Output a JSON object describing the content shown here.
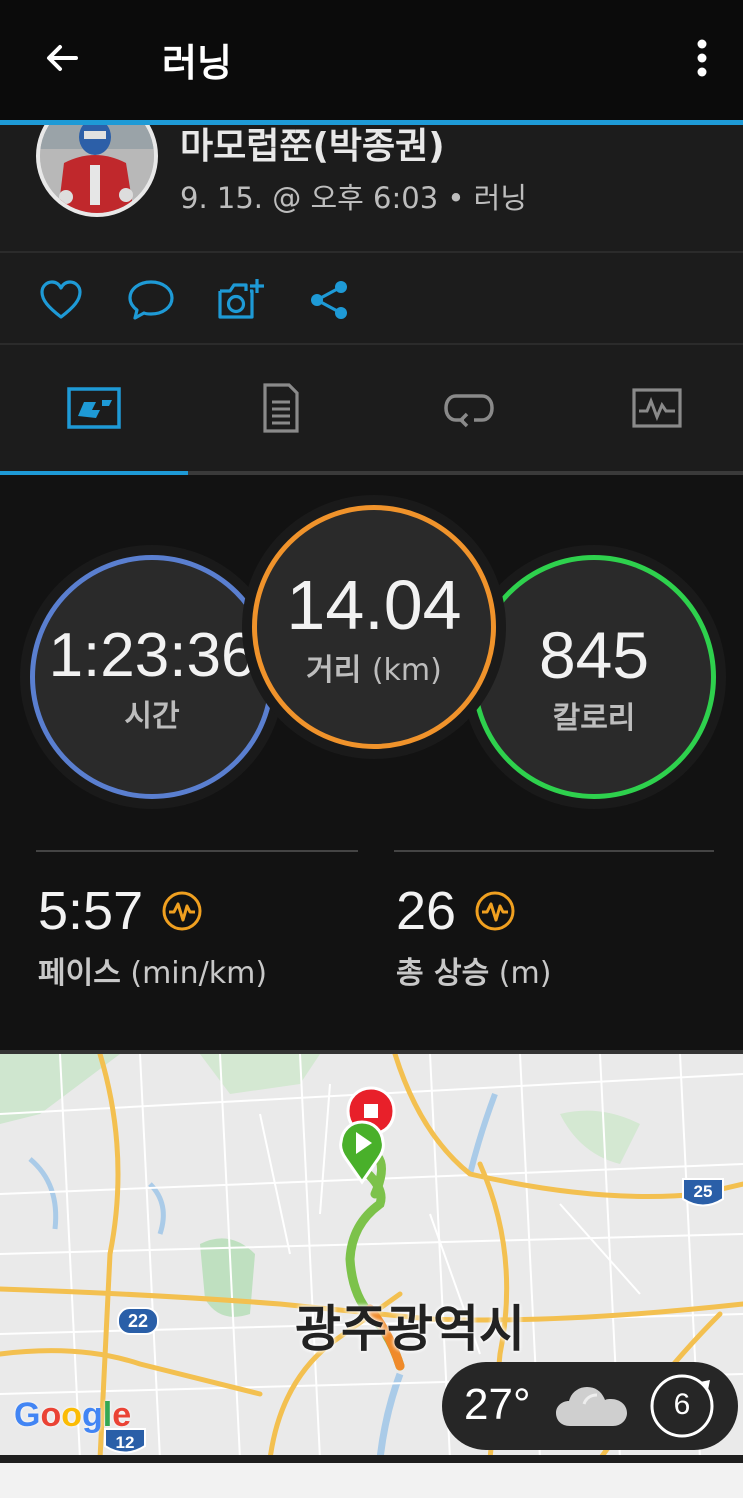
{
  "header": {
    "title": "러닝",
    "back_icon": "arrow-left-icon",
    "more_icon": "more-vertical-icon"
  },
  "activity": {
    "user_name": "마모럽쭌(박종권)",
    "meta": "9. 15. @ 오후 6:03 • 러닝"
  },
  "actions": [
    "heart-icon",
    "comment-icon",
    "add-photo-icon",
    "share-icon"
  ],
  "tabs": [
    "overview-icon",
    "details-icon",
    "laps-icon",
    "charts-icon"
  ],
  "stats": {
    "time": {
      "value": "1:23:36",
      "label": "시간",
      "color": "#4a8fd6"
    },
    "distance": {
      "value": "14.04",
      "label": "거리",
      "unit": "(km)",
      "color": "#f0932b"
    },
    "calories": {
      "value": "845",
      "label": "칼로리",
      "color": "#2ed14d"
    },
    "pace": {
      "value": "5:57",
      "label": "페이스",
      "unit": "(min/km)"
    },
    "elevation": {
      "value": "26",
      "label": "총 상승",
      "unit": "(m)"
    }
  },
  "map": {
    "city_label": "광주광역시",
    "road_badges": [
      "25",
      "22",
      "12"
    ],
    "google_logo": "Google",
    "weather": {
      "temp": "27°",
      "icon": "cloud-icon",
      "wind": "6"
    }
  },
  "colors": {
    "accent": "#1e9ad6",
    "pace_icon": "#f0a020"
  }
}
